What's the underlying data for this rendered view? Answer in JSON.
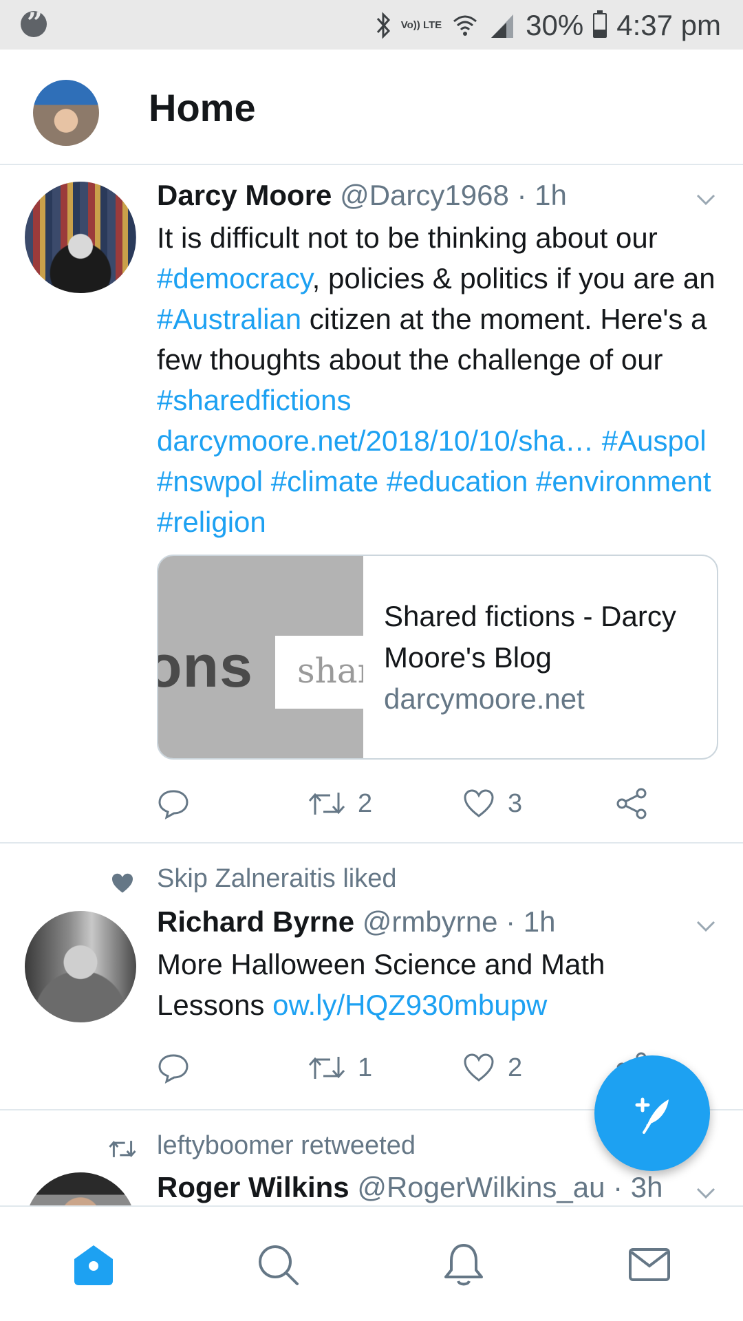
{
  "status_bar": {
    "volte_label": "Vo)) LTE",
    "battery": "30%",
    "time": "4:37 pm",
    "icons": [
      "hangouts-icon",
      "bluetooth-icon",
      "wifi-icon",
      "signal-icon",
      "battery-icon"
    ]
  },
  "header": {
    "title": "Home"
  },
  "tweets": [
    {
      "name": "Darcy Moore",
      "handle": "@Darcy1968",
      "time": "· 1h",
      "body": [
        {
          "text": "It is difficult not to be thinking about our "
        },
        {
          "text": "#democracy",
          "link": true
        },
        {
          "text": ", policies & politics if you are an "
        },
        {
          "text": "#Australian",
          "link": true
        },
        {
          "text": " citizen at the moment. Here's a few thoughts about the challenge of our "
        },
        {
          "text": "#sharedfictions",
          "link": true
        },
        {
          "text": " "
        },
        {
          "text": "darcymoore.net/2018/10/10/sha…",
          "link": true
        },
        {
          "text": " "
        },
        {
          "text": "#Auspol",
          "link": true
        },
        {
          "text": " "
        },
        {
          "text": "#nswpol",
          "link": true
        },
        {
          "text": " "
        },
        {
          "text": "#climate",
          "link": true
        },
        {
          "text": " "
        },
        {
          "text": "#education",
          "link": true
        },
        {
          "text": " "
        },
        {
          "text": "#environment",
          "link": true
        },
        {
          "text": " "
        },
        {
          "text": "#religion",
          "link": true
        }
      ],
      "card": {
        "image_text_large": "ons",
        "image_text_small": "shar",
        "title": "Shared fictions - Darcy Moore's Blog",
        "domain": "darcymoore.net"
      },
      "retweets": "2",
      "likes": "3"
    },
    {
      "social_context": "Skip Zalneraitis liked",
      "name": "Richard Byrne",
      "handle": "@rmbyrne",
      "time": "· 1h",
      "body": [
        {
          "text": "More Halloween Science and Math Lessons "
        },
        {
          "text": "ow.ly/HQZ930mbupw",
          "link": true
        }
      ],
      "retweets": "1",
      "likes": "2"
    },
    {
      "social_context": "leftyboomer retweeted",
      "name": "Roger Wilkins",
      "handle": "@RogerWilkins_au",
      "time": "· 3h"
    }
  ],
  "colors": {
    "accent": "#1da1f2",
    "secondary_text": "#657786",
    "divider": "#e1e8ed"
  },
  "bottom_nav": [
    "home-icon",
    "search-icon",
    "notifications-icon",
    "messages-icon"
  ]
}
